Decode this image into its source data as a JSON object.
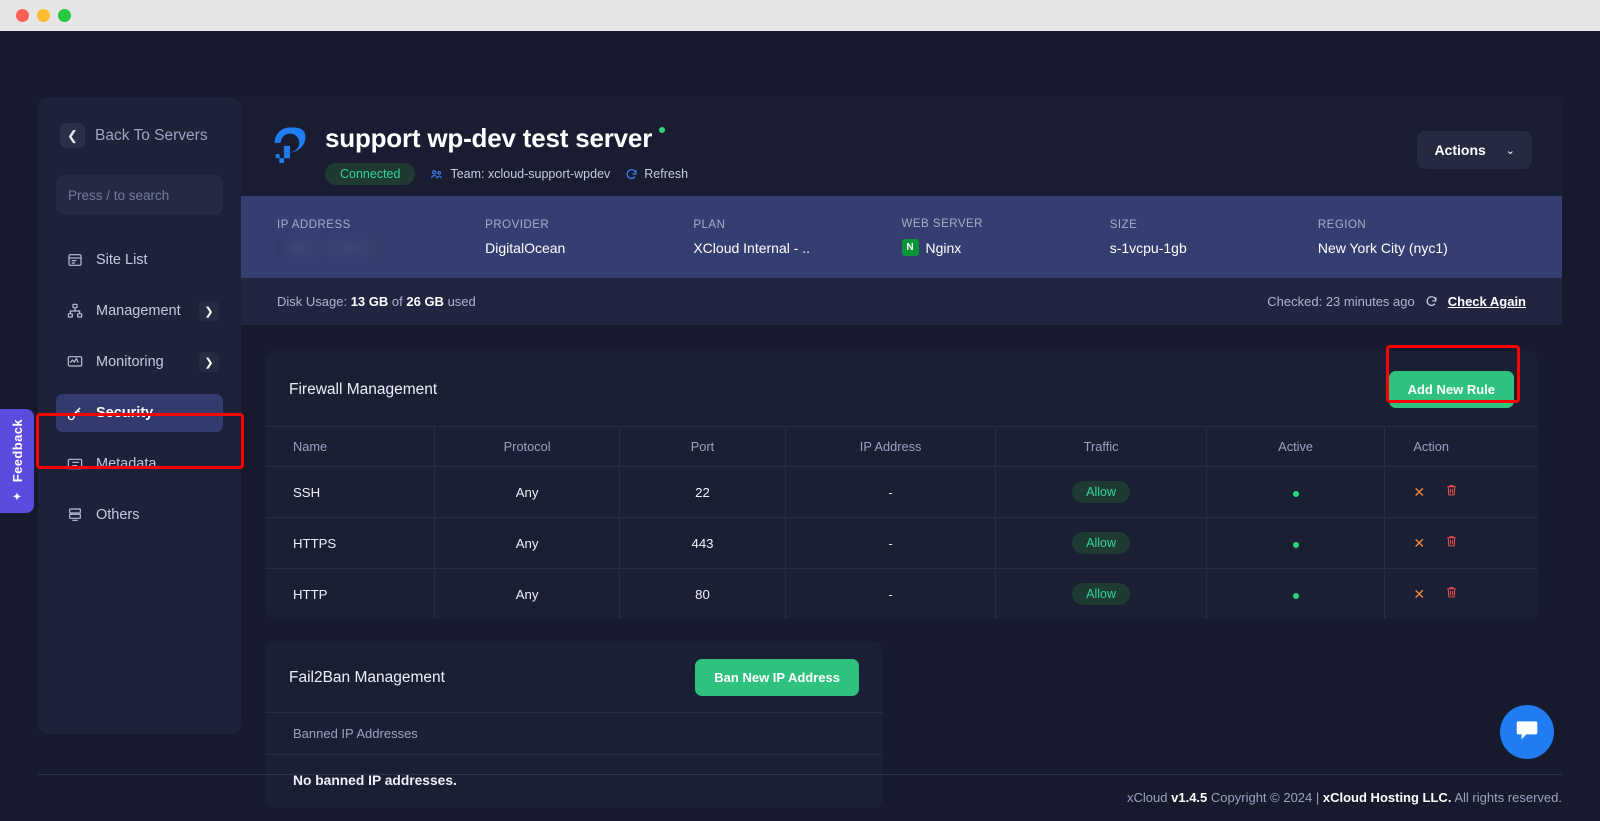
{
  "window": {
    "traffic_lights": [
      "close",
      "minimize",
      "maximize"
    ]
  },
  "feedback": {
    "label": "Feedback",
    "icon": "sparkles-icon"
  },
  "sidebar": {
    "back_label": "Back To Servers",
    "search_placeholder": "Press / to search",
    "search_value": "",
    "items": [
      {
        "label": "Site List",
        "icon": "site-list-icon",
        "expandable": false,
        "active": false
      },
      {
        "label": "Management",
        "icon": "management-icon",
        "expandable": true,
        "active": false
      },
      {
        "label": "Monitoring",
        "icon": "monitoring-icon",
        "expandable": true,
        "active": false
      },
      {
        "label": "Security",
        "icon": "security-key-icon",
        "expandable": false,
        "active": true
      },
      {
        "label": "Metadata",
        "icon": "metadata-icon",
        "expandable": false,
        "active": false
      },
      {
        "label": "Others",
        "icon": "others-icon",
        "expandable": false,
        "active": false
      }
    ]
  },
  "header": {
    "provider_logo": "digitalocean-logo",
    "title": "support wp-dev test server",
    "status_dot_color": "#2bd67b",
    "connected_badge": "Connected",
    "team_label": "Team: xcloud-support-wpdev",
    "team_icon": "team-icon",
    "refresh_label": "Refresh",
    "refresh_icon": "refresh-icon",
    "actions_label": "Actions",
    "actions_chevron": "chevron-down-icon"
  },
  "info_strip": [
    {
      "label": "IP ADDRESS",
      "value": "",
      "redacted": true
    },
    {
      "label": "PROVIDER",
      "value": "DigitalOcean",
      "redacted": false
    },
    {
      "label": "PLAN",
      "value": "XCloud Internal - ..",
      "redacted": false
    },
    {
      "label": "WEB SERVER",
      "value": "Nginx",
      "icon": "nginx-icon",
      "redacted": false
    },
    {
      "label": "SIZE",
      "value": "s-1vcpu-1gb",
      "redacted": false
    },
    {
      "label": "REGION",
      "value": "New York City (nyc1)",
      "redacted": false
    }
  ],
  "disk_strip": {
    "prefix": "Disk Usage:",
    "used": "13 GB",
    "middle": "of",
    "total": "26 GB",
    "suffix": "used",
    "checked_label": "Checked: 23 minutes ago",
    "refresh_icon": "refresh-icon",
    "check_again_label": "Check Again"
  },
  "firewall": {
    "title": "Firewall Management",
    "add_button": "Add New Rule",
    "columns": [
      "Name",
      "Protocol",
      "Port",
      "IP Address",
      "Traffic",
      "Active",
      "Action"
    ],
    "rows": [
      {
        "name": "SSH",
        "protocol": "Any",
        "port": "22",
        "ip": "-",
        "traffic": "Allow",
        "active": true
      },
      {
        "name": "HTTPS",
        "protocol": "Any",
        "port": "443",
        "ip": "-",
        "traffic": "Allow",
        "active": true
      },
      {
        "name": "HTTP",
        "protocol": "Any",
        "port": "80",
        "ip": "-",
        "traffic": "Allow",
        "active": true
      }
    ],
    "action_icons": [
      "close-x-icon",
      "trash-icon"
    ]
  },
  "fail2ban": {
    "title": "Fail2Ban Management",
    "ban_button": "Ban New IP Address",
    "list_header": "Banned IP Addresses",
    "empty_message": "No banned IP addresses."
  },
  "footer": {
    "brand": "xCloud",
    "version": "v1.4.5",
    "copyright": "Copyright © 2024 |",
    "company": "xCloud Hosting LLC.",
    "rights": "All rights reserved."
  },
  "chat": {
    "icon": "chat-bubble-icon"
  },
  "highlights": {
    "color": "#ff0000",
    "targets": [
      "sidebar-item-security",
      "add-new-rule-button"
    ]
  }
}
